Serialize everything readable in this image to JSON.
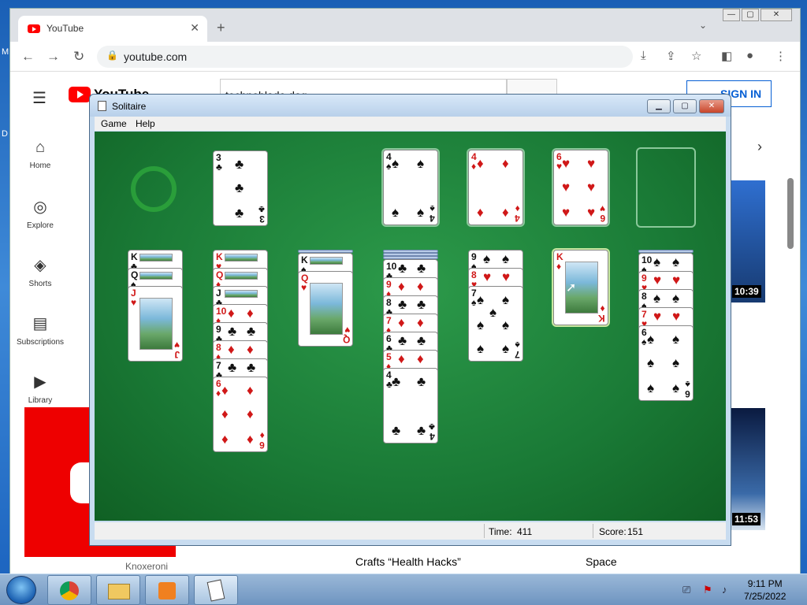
{
  "desktop": {
    "side_letters": [
      "M",
      "D"
    ]
  },
  "browser": {
    "tab_title": "YouTube",
    "tab_close": "✕",
    "new_tab": "+",
    "tab_search": "⌄",
    "window_buttons": [
      "—",
      "▢",
      "✕"
    ],
    "url": "youtube.com",
    "nav": {
      "back": "←",
      "forward": "→",
      "reload": "↻"
    },
    "toolbar_icons": [
      "install-icon",
      "share-icon",
      "star-icon",
      "sidepanel-icon",
      "profile-icon",
      "menu-icon"
    ]
  },
  "youtube": {
    "logo_text": "YouTube",
    "search_value": "technoblade dog",
    "sign_in": "SIGN IN",
    "nav": [
      {
        "label": "Home",
        "icon": "⌂"
      },
      {
        "label": "Explore",
        "icon": "◎"
      },
      {
        "label": "Shorts",
        "icon": "◈"
      },
      {
        "label": "Subscriptions",
        "icon": "▤"
      },
      {
        "label": "Library",
        "icon": "▶"
      }
    ],
    "durations": [
      "10:39",
      "11:53"
    ],
    "channels": [
      "Knoxeroni"
    ],
    "video_titles": [
      "Crafts “Health Hacks”",
      "Space"
    ]
  },
  "solitaire": {
    "title": "Solitaire",
    "menu": [
      "Game",
      "Help"
    ],
    "time_label": "Time:",
    "time_value": "411",
    "score_label": "Score:",
    "score_value": "151",
    "window_buttons": [
      "▁",
      "▢",
      "✕"
    ],
    "waste": {
      "rank": "3",
      "suit": "♣"
    },
    "foundations": [
      {
        "rank": "4",
        "suit": "♠"
      },
      {
        "rank": "4",
        "suit": "♦"
      },
      {
        "rank": "6",
        "suit": "♥"
      },
      {
        "rank": "",
        "suit": ""
      }
    ],
    "tableau": [
      {
        "facedown": 0,
        "cards": [
          [
            "K",
            "♣"
          ],
          [
            "Q",
            "♠"
          ],
          [
            "J",
            "♥"
          ]
        ]
      },
      {
        "facedown": 0,
        "cards": [
          [
            "K",
            "♥"
          ],
          [
            "Q",
            "♦"
          ],
          [
            "J",
            "♣"
          ],
          [
            "10",
            "♦"
          ],
          [
            "9",
            "♣"
          ],
          [
            "8",
            "♦"
          ],
          [
            "7",
            "♣"
          ],
          [
            "6",
            "♦"
          ]
        ]
      },
      {
        "facedown": 1,
        "cards": [
          [
            "K",
            "♠"
          ],
          [
            "Q",
            "♥"
          ]
        ]
      },
      {
        "facedown": 3,
        "cards": [
          [
            "10",
            "♣"
          ],
          [
            "9",
            "♦"
          ],
          [
            "8",
            "♣"
          ],
          [
            "7",
            "♦"
          ],
          [
            "6",
            "♣"
          ],
          [
            "5",
            "♦"
          ],
          [
            "4",
            "♣"
          ]
        ]
      },
      {
        "facedown": 0,
        "cards": [
          [
            "9",
            "♠"
          ],
          [
            "8",
            "♥"
          ],
          [
            "7",
            "♠"
          ]
        ]
      },
      {
        "facedown": 0,
        "cards": [
          [
            "K",
            "♦"
          ]
        ]
      },
      {
        "facedown": 1,
        "cards": [
          [
            "10",
            "♠"
          ],
          [
            "9",
            "♥"
          ],
          [
            "8",
            "♠"
          ],
          [
            "7",
            "♥"
          ],
          [
            "6",
            "♠"
          ]
        ]
      }
    ]
  },
  "taskbar": {
    "time": "9:11 PM",
    "date": "7/25/2022",
    "apps": [
      "chrome-icon",
      "explorer-icon",
      "media-player-icon",
      "solitaire-icon"
    ]
  }
}
